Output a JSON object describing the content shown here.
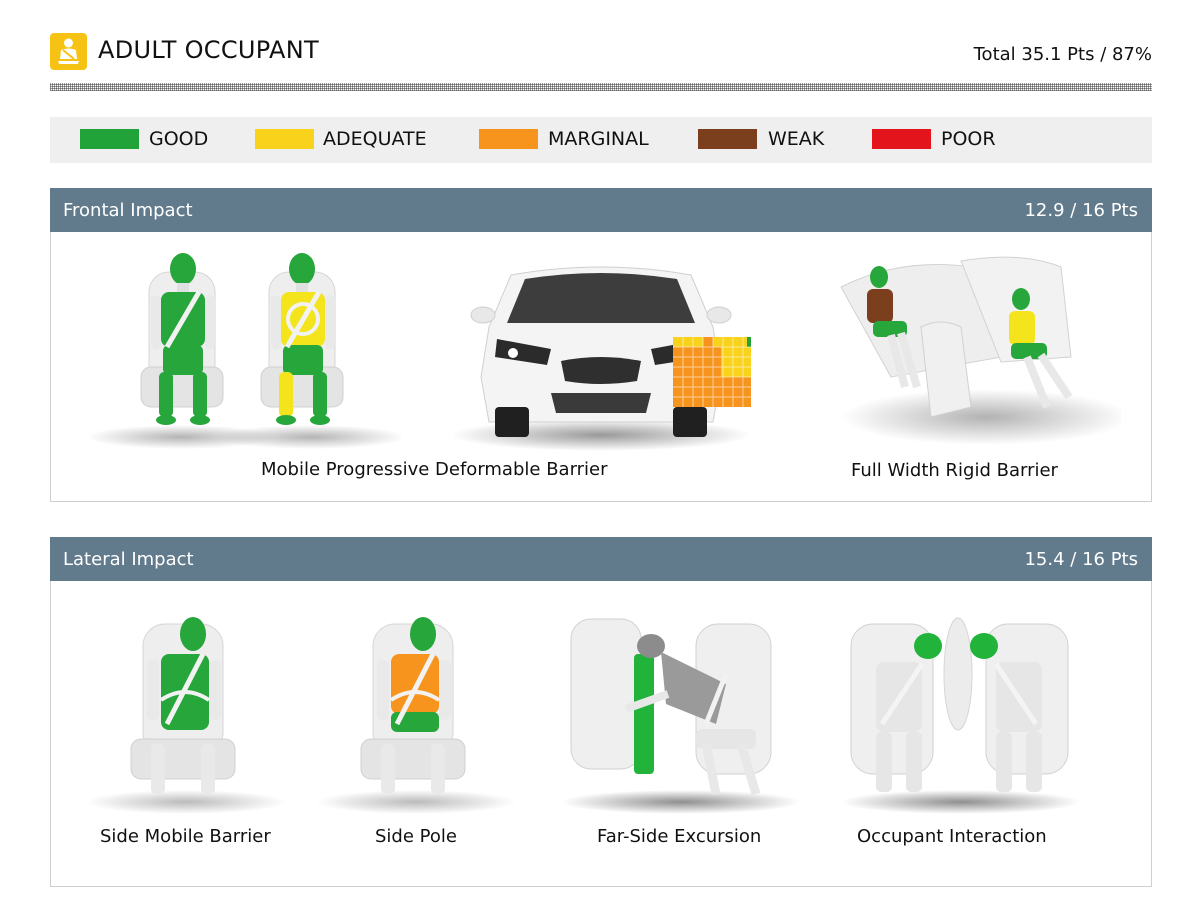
{
  "header": {
    "title": "ADULT OCCUPANT",
    "total": "Total 35.1 Pts / 87%",
    "icon": "seated-occupant-icon"
  },
  "legend": [
    {
      "label": "GOOD",
      "color": "#22a33a"
    },
    {
      "label": "ADEQUATE",
      "color": "#f9d21b"
    },
    {
      "label": "MARGINAL",
      "color": "#f7941d"
    },
    {
      "label": "WEAK",
      "color": "#7b3f1e"
    },
    {
      "label": "POOR",
      "color": "#e3141b"
    }
  ],
  "frontal": {
    "title": "Frontal Impact",
    "score": "12.9 / 16 Pts",
    "captions": {
      "mpdb": "Mobile Progressive Deformable Barrier",
      "fwrb": "Full Width Rigid Barrier"
    }
  },
  "lateral": {
    "title": "Lateral Impact",
    "score": "15.4 / 16 Pts",
    "captions": {
      "side_mobile": "Side Mobile Barrier",
      "side_pole": "Side Pole",
      "far_side": "Far-Side Excursion",
      "occupant_interaction": "Occupant Interaction"
    }
  },
  "colors": {
    "good": "#22a33a",
    "adequate": "#f9d21b",
    "marginal": "#f7941d",
    "weak": "#7b3f1e",
    "poor": "#e3141b",
    "panel_bar": "#617a8c",
    "header_icon": "#f6c315"
  }
}
